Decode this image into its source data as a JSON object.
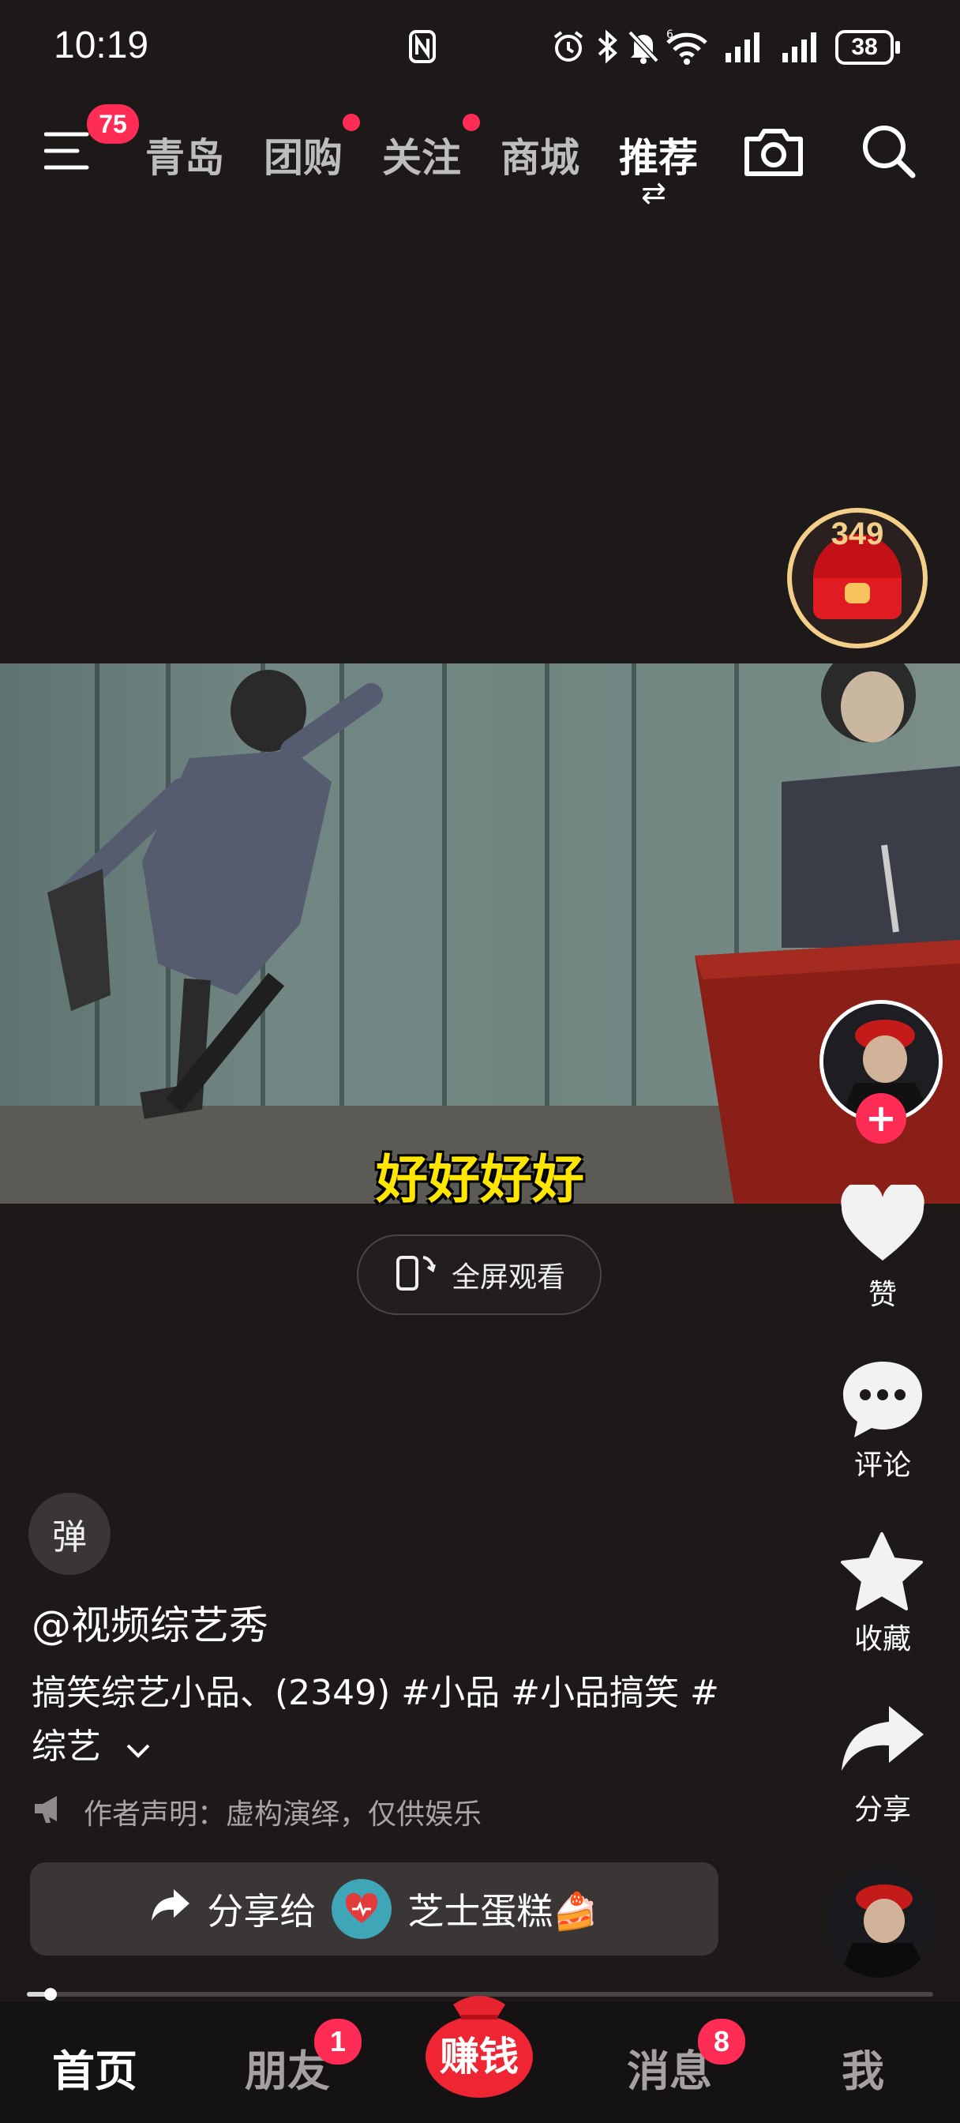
{
  "status_bar": {
    "time": "10:19",
    "battery": "38",
    "icons": [
      "nfc-icon",
      "alarm-icon",
      "bluetooth-icon",
      "mute-icon",
      "wifi-6-icon",
      "signal-1-icon",
      "signal-2-icon",
      "battery-icon"
    ]
  },
  "top_nav": {
    "menu_badge": "75",
    "tabs": [
      {
        "label": "青岛",
        "dot": false
      },
      {
        "label": "团购",
        "dot": true
      },
      {
        "label": "关注",
        "dot": true
      },
      {
        "label": "商城",
        "dot": false
      },
      {
        "label": "推荐",
        "active": true
      }
    ],
    "swap_symbol": "⇄"
  },
  "red_packet": {
    "count": "349"
  },
  "video": {
    "subtitle": "好好好好",
    "fullscreen_label": "全屏观看"
  },
  "right_rail": {
    "follow_symbol": "+",
    "like_label": "赞",
    "comment_label": "评论",
    "favorite_label": "收藏",
    "share_label": "分享"
  },
  "post": {
    "danmaku_label": "弹",
    "author": "@视频综艺秀",
    "description": "搞笑综艺小品、(2349) #小品 #小品搞笑 #综艺",
    "declaration": "作者声明：虚构演绎，仅供娱乐",
    "share_to_label": "分享给",
    "share_target": "芝士蛋糕🍰"
  },
  "playback": {
    "progress": 0.026
  },
  "bottom_nav": {
    "items": [
      {
        "label": "首页",
        "active": true
      },
      {
        "label": "朋友",
        "badge": "1"
      },
      {
        "label": "赚钱"
      },
      {
        "label": "消息",
        "badge": "8"
      },
      {
        "label": "我"
      }
    ]
  },
  "colors": {
    "accent": "#ff2d55",
    "background": "#1d1918",
    "subtitle": "#ffe600"
  }
}
